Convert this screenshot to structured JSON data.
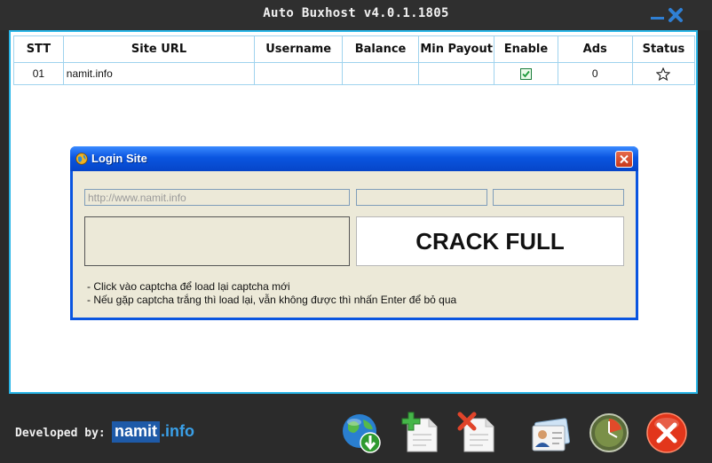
{
  "window": {
    "title": "Auto Buxhost v4.0.1.1805"
  },
  "table": {
    "columns": [
      "STT",
      "Site URL",
      "Username",
      "Balance",
      "Min Payout",
      "Enable",
      "Ads",
      "Status"
    ],
    "rows": [
      {
        "stt": "01",
        "url": "namit.info",
        "username": "",
        "balance": "",
        "min_payout": "",
        "enabled": true,
        "ads": "0",
        "status_icon": "star-outline-icon"
      }
    ]
  },
  "dialog": {
    "title": "Login Site",
    "url_field_value": "http://www.namit.info",
    "username_value": "",
    "password_value": "",
    "captcha_text": "CRACK FULL",
    "notes": [
      "- Click vào captcha để load lại captcha mới",
      "- Nếu gặp captcha trắng thì load lại, vẫn không được thì nhấn Enter để bỏ qua"
    ]
  },
  "footer": {
    "developed_by": "Developed by:",
    "brand_a": "namit",
    "brand_b": ".info",
    "tools": [
      "globe-download-icon",
      "add-document-icon",
      "delete-document-icon",
      "contact-card-icon",
      "clock-icon",
      "exit-icon"
    ]
  },
  "colors": {
    "accent": "#29b6e8",
    "dialog_title": "#0a55e0",
    "dialog_body": "#ece9d8",
    "exit": "#e2361b"
  }
}
